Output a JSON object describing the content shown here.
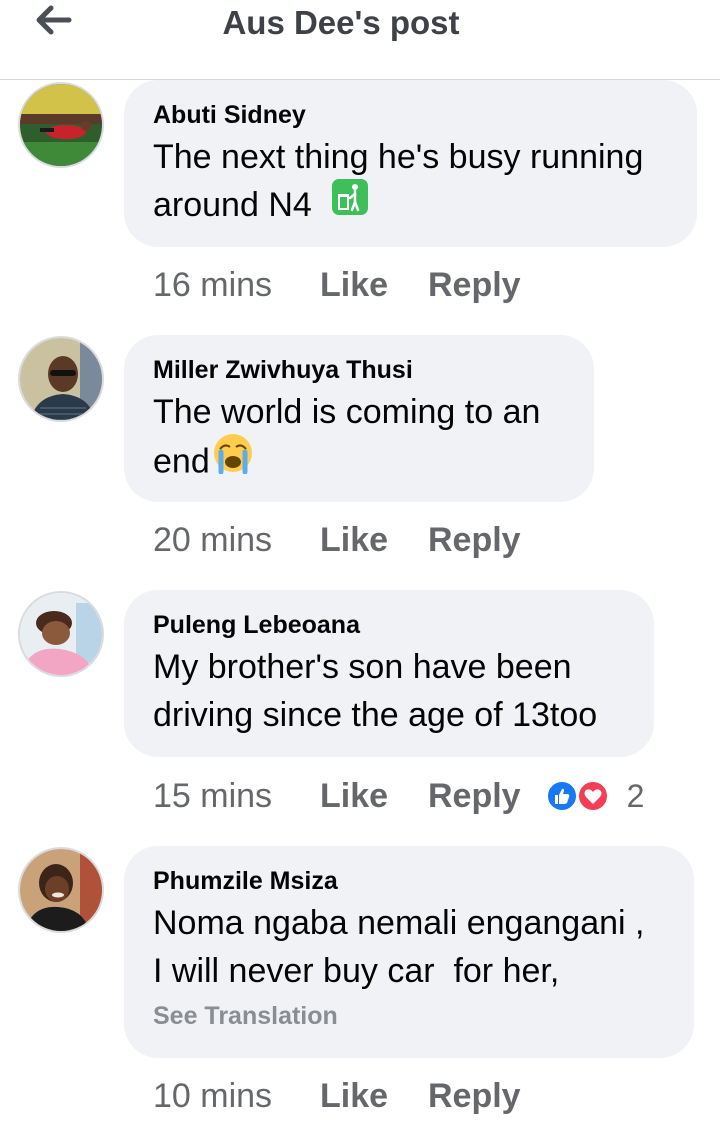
{
  "header": {
    "title": "Aus Dee's post",
    "back_icon": "arrow-left-icon"
  },
  "colors": {
    "bubble_bg": "#f0f2f5",
    "meta_text": "#65676b",
    "like_blue": "#1877f2",
    "love_red": "#f33e58"
  },
  "comments": [
    {
      "author": "Abuti Sidney",
      "text_lines": [
        "The next thing he's busy running",
        "around N4"
      ],
      "emoji": "trash-can-emoji",
      "time": "16 mins",
      "like_label": "Like",
      "reply_label": "Reply"
    },
    {
      "author": "Miller Zwivhuya Thusi",
      "text_lines": [
        "The world is coming to an",
        "end"
      ],
      "emoji": "crying-face-emoji",
      "time": "20 mins",
      "like_label": "Like",
      "reply_label": "Reply"
    },
    {
      "author": "Puleng Lebeoana",
      "text_lines": [
        "My brother's son have been",
        "driving since the age of 13too"
      ],
      "time": "15 mins",
      "like_label": "Like",
      "reply_label": "Reply",
      "reactions": {
        "icons": [
          "like-icon",
          "love-icon"
        ],
        "count": "2"
      }
    },
    {
      "author": "Phumzile Msiza",
      "text_lines": [
        "Noma ngaba nemali engangani ,",
        "I will never buy car  for her,"
      ],
      "see_translation": "See Translation",
      "time": "10 mins",
      "like_label": "Like",
      "reply_label": "Reply"
    }
  ]
}
